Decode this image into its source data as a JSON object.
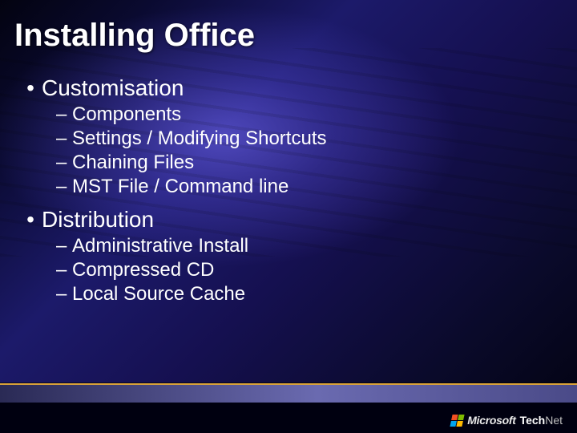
{
  "title": "Installing Office",
  "sections": [
    {
      "label": "Customisation",
      "items": [
        "Components",
        "Settings / Modifying Shortcuts",
        "Chaining Files",
        "MST File / Command line"
      ]
    },
    {
      "label": "Distribution",
      "items": [
        "Administrative Install",
        "Compressed CD",
        "Local Source Cache"
      ]
    }
  ],
  "brand": {
    "company": "Microsoft",
    "product_a": "Tech",
    "product_b": "Net"
  }
}
